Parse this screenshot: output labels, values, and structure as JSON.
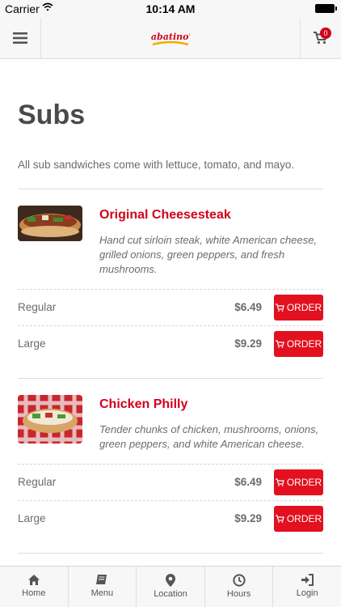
{
  "status_bar": {
    "carrier": "Carrier",
    "time": "10:14 AM"
  },
  "header": {
    "logo_text": "Sabatino's",
    "cart_count": "0"
  },
  "page": {
    "title": "Subs",
    "description": "All sub sandwiches come with lettuce, tomato, and mayo."
  },
  "items": [
    {
      "name": "Original Cheesesteak",
      "description": "Hand cut sirloin steak, white American cheese, grilled onions, green peppers, and fresh mushrooms.",
      "options": [
        {
          "size": "Regular",
          "price": "$6.49",
          "button": "ORDER"
        },
        {
          "size": "Large",
          "price": "$9.29",
          "button": "ORDER"
        }
      ]
    },
    {
      "name": "Chicken Philly",
      "description": "Tender chunks of chicken, mushrooms, onions, green peppers, and white American cheese.",
      "options": [
        {
          "size": "Regular",
          "price": "$6.49",
          "button": "ORDER"
        },
        {
          "size": "Large",
          "price": "$9.29",
          "button": "ORDER"
        }
      ]
    }
  ],
  "tabs": [
    {
      "label": "Home",
      "icon": "home-icon"
    },
    {
      "label": "Menu",
      "icon": "book-icon"
    },
    {
      "label": "Location",
      "icon": "map-marker-icon"
    },
    {
      "label": "Hours",
      "icon": "clock-icon"
    },
    {
      "label": "Login",
      "icon": "sign-in-icon"
    }
  ],
  "colors": {
    "accent": "#d0021b",
    "button": "#e3101f",
    "bar_bg": "#f7f7f7"
  }
}
